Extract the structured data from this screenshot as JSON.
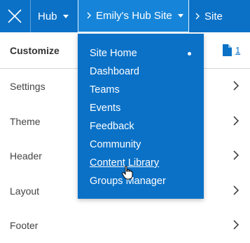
{
  "topbar": {
    "hub_label": "Hub",
    "site_label": "Emily's Hub Site",
    "next_crumb": "Site"
  },
  "panel": {
    "title": "Customize",
    "page_count": "1",
    "rows": [
      {
        "label": "Settings"
      },
      {
        "label": "Theme"
      },
      {
        "label": "Header"
      },
      {
        "label": "Layout"
      },
      {
        "label": "Footer"
      }
    ]
  },
  "dropdown": {
    "items": [
      {
        "label": "Site Home",
        "active": true
      },
      {
        "label": "Dashboard"
      },
      {
        "label": "Teams"
      },
      {
        "label": "Events"
      },
      {
        "label": "Feedback"
      },
      {
        "label": "Community"
      },
      {
        "label": "Content Library",
        "hovered": true
      },
      {
        "label": "Groups Manager"
      }
    ]
  },
  "colors": {
    "brand": "#0a71c7",
    "brand_active": "#1685d9",
    "text": "#444444"
  },
  "icons": [
    "close-icon",
    "caret-down-icon",
    "chevron-right-icon",
    "page-icon",
    "hand-cursor-icon"
  ]
}
